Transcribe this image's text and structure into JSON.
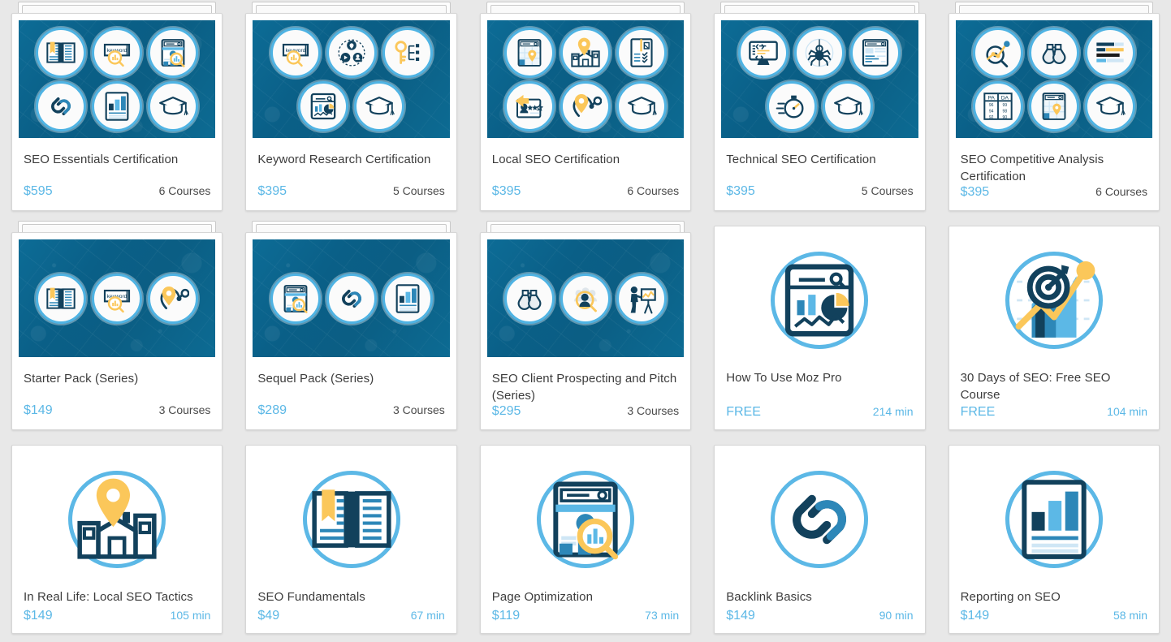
{
  "theme": {
    "page_bg": "#e8e8e8",
    "card_bg": "#ffffff",
    "hero_bg": "#0b6188",
    "accent_blue": "#5cb8e6",
    "icon_navy": "#12415c",
    "icon_yellow": "#fbc75a",
    "title_color": "#3c3c3c"
  },
  "cards": [
    {
      "id": "seo-essentials-certification",
      "title": "SEO Essentials Certification",
      "price": "$595",
      "extent": "6 Courses",
      "extent_style": "dark",
      "type": "certification",
      "stacked": true,
      "badges": [
        [
          "book-icon",
          "keyword-search-icon",
          "site-audit-icon"
        ],
        [
          "link-icon",
          "bar-chart-report-icon",
          "graduation-cap-icon"
        ]
      ]
    },
    {
      "id": "keyword-research-certification",
      "title": "Keyword Research Certification",
      "price": "$395",
      "extent": "5 Courses",
      "extent_style": "dark",
      "type": "certification",
      "stacked": true,
      "badges": [
        [
          "keyword-search-icon",
          "audience-network-icon",
          "key-icon"
        ],
        [
          "analytics-dashboard-icon",
          "graduation-cap-icon"
        ]
      ]
    },
    {
      "id": "local-seo-certification",
      "title": "Local SEO Certification",
      "price": "$395",
      "extent": "6 Courses",
      "extent_style": "dark",
      "type": "certification",
      "stacked": true,
      "badges": [
        [
          "map-search-icon",
          "storefront-pin-icon",
          "checklist-icon"
        ],
        [
          "review-card-icon",
          "location-pin-path-icon",
          "graduation-cap-icon"
        ]
      ]
    },
    {
      "id": "technical-seo-certification",
      "title": "Technical SEO Certification",
      "price": "$395",
      "extent": "5 Courses",
      "extent_style": "dark",
      "type": "certification",
      "stacked": true,
      "badges": [
        [
          "code-monitor-icon",
          "crawler-spider-icon",
          "serp-page-icon"
        ],
        [
          "stopwatch-speed-icon",
          "graduation-cap-icon"
        ]
      ]
    },
    {
      "id": "seo-competitive-analysis-certification",
      "title": "SEO Competitive Analysis Certification",
      "price": "$395",
      "extent": "6 Courses",
      "extent_style": "dark",
      "type": "certification",
      "stacked": true,
      "badges": [
        [
          "magnifier-target-icon",
          "binoculars-icon",
          "compare-bars-icon"
        ],
        [
          "pa-da-table-icon",
          "map-search-icon",
          "graduation-cap-icon"
        ]
      ]
    },
    {
      "id": "starter-pack-series",
      "title": "Starter Pack (Series)",
      "price": "$149",
      "extent": "3 Courses",
      "extent_style": "dark",
      "type": "certification",
      "stacked": true,
      "badges": [
        [
          "book-icon",
          "keyword-search-icon",
          "location-pin-path-icon"
        ]
      ]
    },
    {
      "id": "sequel-pack-series",
      "title": "Sequel Pack (Series)",
      "price": "$289",
      "extent": "3 Courses",
      "extent_style": "dark",
      "type": "certification",
      "stacked": true,
      "badges": [
        [
          "site-audit-icon",
          "link-icon",
          "bar-chart-report-icon"
        ]
      ]
    },
    {
      "id": "seo-client-prospecting-and-pitch-series",
      "title": "SEO Client Prospecting and Pitch (Series)",
      "price": "$295",
      "extent": "3 Courses",
      "extent_style": "dark",
      "type": "certification",
      "stacked": true,
      "badges": [
        [
          "binoculars-icon",
          "audience-magnifier-icon",
          "presenter-icon"
        ]
      ]
    },
    {
      "id": "how-to-use-moz-pro",
      "title": "How To Use Moz Pro",
      "price": "FREE",
      "extent": "214 min",
      "extent_style": "blue",
      "type": "course",
      "stacked": false,
      "icon": "analytics-dashboard-icon"
    },
    {
      "id": "30-days-of-seo-free-seo-course",
      "title": "30 Days of SEO: Free SEO Course",
      "price": "FREE",
      "extent": "104 min",
      "extent_style": "blue",
      "type": "course",
      "stacked": false,
      "icon": "target-growth-icon"
    },
    {
      "id": "in-real-life-local-seo-tactics",
      "title": "In Real Life: Local SEO Tactics",
      "price": "$149",
      "extent": "105 min",
      "extent_style": "blue",
      "type": "course",
      "stacked": false,
      "icon": "storefront-pin-icon"
    },
    {
      "id": "seo-fundamentals",
      "title": "SEO Fundamentals",
      "price": "$49",
      "extent": "67 min",
      "extent_style": "blue",
      "type": "course",
      "stacked": false,
      "icon": "book-icon"
    },
    {
      "id": "page-optimization",
      "title": "Page Optimization",
      "price": "$119",
      "extent": "73 min",
      "extent_style": "blue",
      "type": "course",
      "stacked": false,
      "icon": "site-audit-icon"
    },
    {
      "id": "backlink-basics",
      "title": "Backlink Basics",
      "price": "$149",
      "extent": "90 min",
      "extent_style": "blue",
      "type": "course",
      "stacked": false,
      "icon": "link-icon"
    },
    {
      "id": "reporting-on-seo",
      "title": "Reporting on SEO",
      "price": "$149",
      "extent": "58 min",
      "extent_style": "blue",
      "type": "course",
      "stacked": false,
      "icon": "bar-chart-report-icon"
    }
  ],
  "icon_labels": {
    "book-icon": "open book",
    "keyword-search-icon": "keyword search box with magnifier",
    "site-audit-icon": "browser page with magnifier",
    "link-icon": "chain link",
    "bar-chart-report-icon": "report with bar chart",
    "graduation-cap-icon": "graduation cap",
    "audience-network-icon": "audience network circles",
    "key-icon": "key with nodes",
    "analytics-dashboard-icon": "analytics dashboard",
    "map-search-icon": "map with pin in browser",
    "storefront-pin-icon": "storefront with map pin",
    "checklist-icon": "checklist document",
    "review-card-icon": "review card with stars",
    "location-pin-path-icon": "map pin with path",
    "code-monitor-icon": "monitor with code",
    "crawler-spider-icon": "crawler spider",
    "serp-page-icon": "search results page",
    "stopwatch-speed-icon": "stopwatch speed",
    "magnifier-target-icon": "magnifier with target path",
    "binoculars-icon": "binoculars",
    "compare-bars-icon": "comparison bars",
    "pa-da-table-icon": "PA DA metrics table",
    "audience-magnifier-icon": "person in crowd under magnifier",
    "presenter-icon": "presenter at whiteboard",
    "target-growth-icon": "target with growth chart"
  }
}
